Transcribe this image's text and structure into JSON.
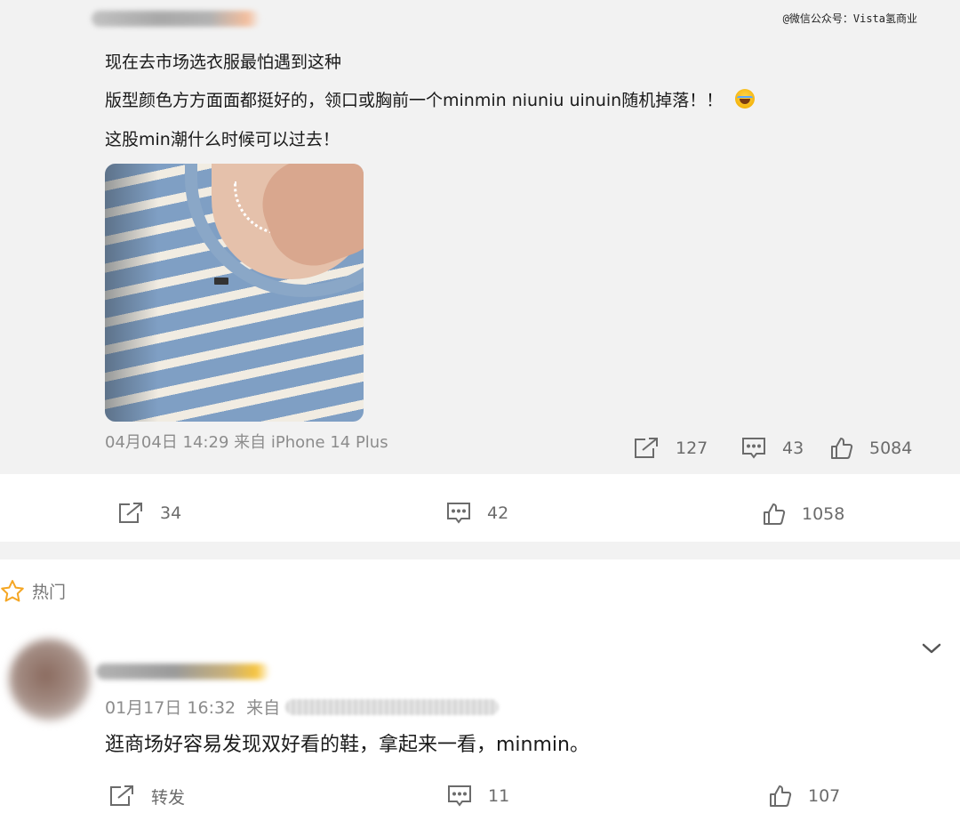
{
  "watermark": "@微信公众号：Vista氢商业",
  "quoted_post": {
    "lines": [
      "现在去市场选衣服最怕遇到这种",
      "版型颜色方方面面都挺好的，领口或胸前一个minmin niuniu uinuin随机掉落！！",
      "这股min潮什么时候可以过去！"
    ],
    "emoji": "laughing-crying-emoji",
    "meta": "04月04日 14:29 来自 iPhone 14 Plus",
    "repost_count": "127",
    "comment_count": "43",
    "like_count": "5084"
  },
  "main_actions": {
    "repost_count": "34",
    "comment_count": "42",
    "like_count": "1058"
  },
  "hot_section": {
    "label": "热门"
  },
  "comment": {
    "date": "01月17日 16:32",
    "from_label": "来自",
    "text": "逛商场好容易发现双好看的鞋，拿起来一看，minmin。",
    "repost_label": "转发",
    "comment_count": "11",
    "like_count": "107"
  },
  "colors": {
    "page_gray": "#f2f2f2",
    "text_gray": "#8c8c8c",
    "icon_gray": "#6b6b6b",
    "star": "#f5a623"
  }
}
